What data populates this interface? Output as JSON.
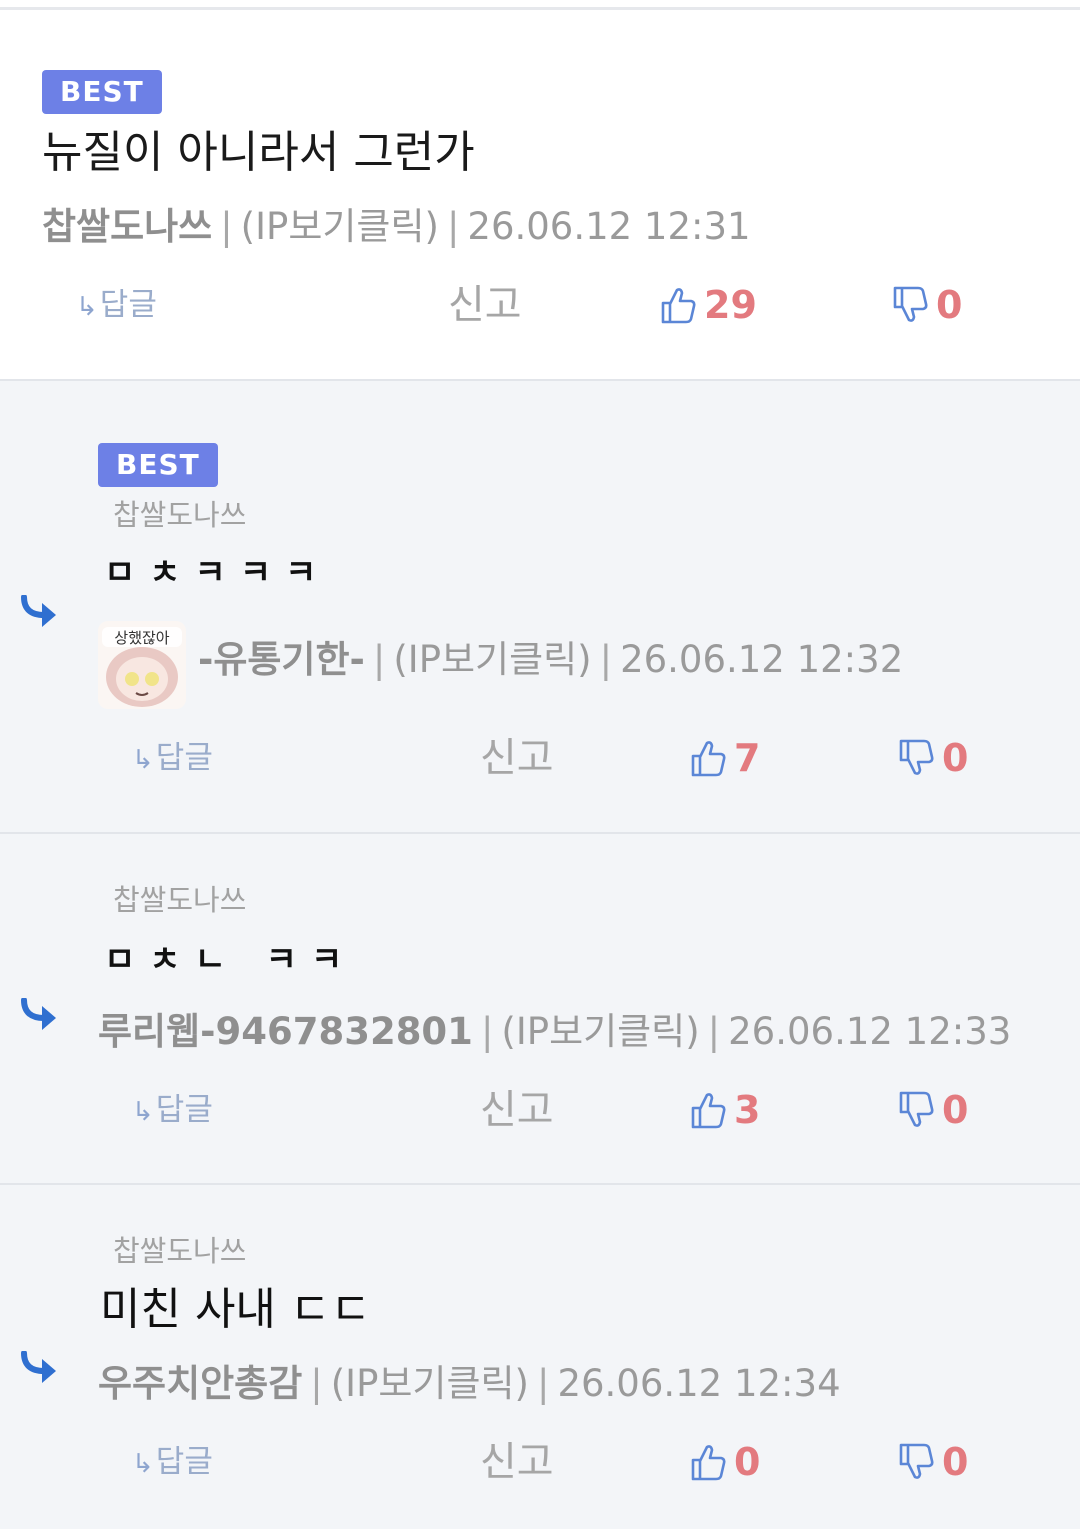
{
  "colors": {
    "badge": "#6d80e6",
    "vote_count": "#e37a7f",
    "icon_blue": "#5b86d6",
    "reply_arrow": "#2f6fd0"
  },
  "comments": [
    {
      "badge": "BEST",
      "text": "뉴질이 아니라서 그런가",
      "author": "찹쌀도나쓰",
      "ip": "(IP보기클릭)",
      "time": "26.06.12 12:31",
      "reply_label": "답글",
      "report_label": "신고",
      "up": "29",
      "down": "0"
    },
    {
      "badge": "BEST",
      "target": "찹쌀도나쓰",
      "text": "ㅁㅊㅋㅋㅋ",
      "avatar_icon": "anime-girl-avatar-icon",
      "author": "-유통기한-",
      "ip": "(IP보기클릭)",
      "time": "26.06.12 12:32",
      "reply_label": "답글",
      "report_label": "신고",
      "up": "7",
      "down": "0"
    },
    {
      "target": "찹쌀도나쓰",
      "text": "ㅁㅊㄴ ㅋㅋ",
      "author": "루리웹-9467832801",
      "ip": "(IP보기클릭)",
      "time": "26.06.12 12:33",
      "reply_label": "답글",
      "report_label": "신고",
      "up": "3",
      "down": "0"
    },
    {
      "target": "찹쌀도나쓰",
      "text": "미친 사내 ㄷㄷ",
      "author": "우주치안총감",
      "ip": "(IP보기클릭)",
      "time": "26.06.12 12:34",
      "reply_label": "답글",
      "report_label": "신고",
      "up": "0",
      "down": "0"
    }
  ]
}
